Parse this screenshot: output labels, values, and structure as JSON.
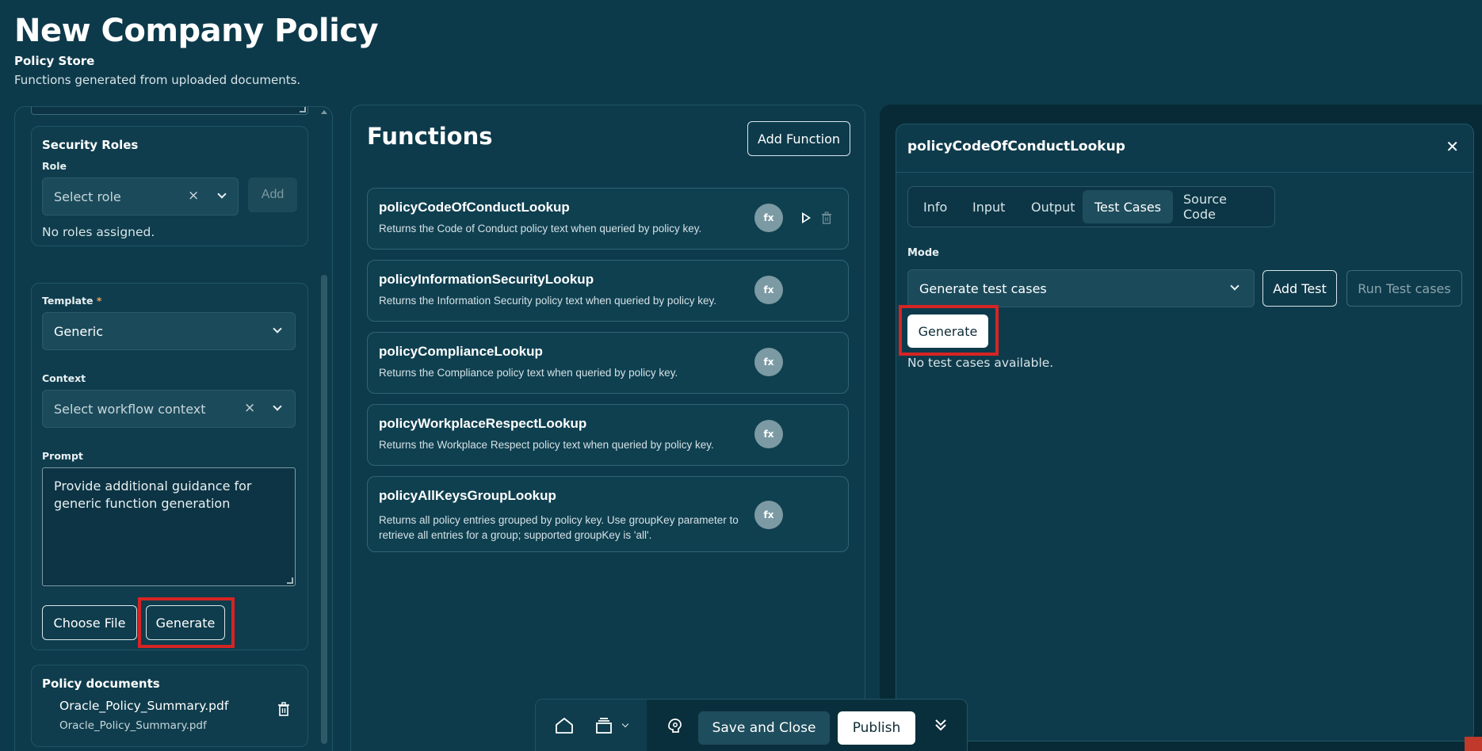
{
  "header": {
    "title": "New Company Policy",
    "subtitle": "Policy Store",
    "description": "Functions generated from uploaded documents."
  },
  "left_panel": {
    "security_roles": {
      "title": "Security Roles",
      "role_label": "Role",
      "role_placeholder": "Select role",
      "add_label": "Add",
      "empty_text": "No roles assigned."
    },
    "template": {
      "label": "Template",
      "required_mark": "*",
      "value": "Generic"
    },
    "context": {
      "label": "Context",
      "placeholder": "Select workflow context"
    },
    "prompt": {
      "label": "Prompt",
      "value": "Provide additional guidance for generic function generation"
    },
    "choose_file_label": "Choose File",
    "generate_label": "Generate",
    "policy_documents": {
      "title": "Policy documents",
      "items": [
        {
          "name": "Oracle_Policy_Summary.pdf",
          "file": "Oracle_Policy_Summary.pdf"
        }
      ]
    }
  },
  "functions_panel": {
    "title": "Functions",
    "add_function_label": "Add Function",
    "badge_label": "fx",
    "items": [
      {
        "name": "policyCodeOfConductLookup",
        "description": "Returns the Code of Conduct policy text when queried by policy key."
      },
      {
        "name": "policyInformationSecurityLookup",
        "description": "Returns the Information Security policy text when queried by policy key."
      },
      {
        "name": "policyComplianceLookup",
        "description": "Returns the Compliance policy text when queried by policy key."
      },
      {
        "name": "policyWorkplaceRespectLookup",
        "description": "Returns the Workplace Respect policy text when queried by policy key."
      },
      {
        "name": "policyAllKeysGroupLookup",
        "description": "Returns all policy entries grouped by policy key. Use groupKey parameter to retrieve all entries for a group; supported groupKey is 'all'."
      }
    ]
  },
  "detail_panel": {
    "title": "policyCodeOfConductLookup",
    "tabs": [
      "Info",
      "Input",
      "Output",
      "Test Cases",
      "Source Code"
    ],
    "active_tab": "Test Cases",
    "mode_label": "Mode",
    "mode_value": "Generate test cases",
    "add_test_label": "Add Test",
    "run_tests_label": "Run Test cases",
    "generate_label": "Generate",
    "empty_text": "No test cases available."
  },
  "toolbar": {
    "save_close_label": "Save and Close",
    "publish_label": "Publish"
  },
  "colors": {
    "background": "#0d3a4a",
    "panel": "#0e3b4b",
    "highlight": "#d62424",
    "primary_button": "#ffffff"
  }
}
